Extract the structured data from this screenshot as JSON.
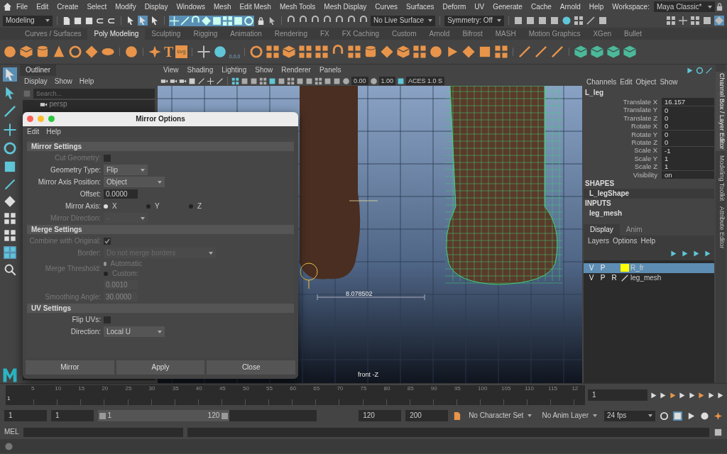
{
  "menu_bar": {
    "items": [
      "File",
      "Edit",
      "Create",
      "Select",
      "Modify",
      "Display",
      "Windows",
      "Mesh",
      "Edit Mesh",
      "Mesh Tools",
      "Mesh Display",
      "Curves",
      "Surfaces",
      "Deform",
      "UV",
      "Generate",
      "Cache",
      "Arnold",
      "Help"
    ],
    "workspace_label": "Workspace:",
    "workspace": "Maya Classic*"
  },
  "status_line": {
    "mode": "Modeling",
    "live_surface": "No Live Surface",
    "symmetry": "Symmetry: Off"
  },
  "shelf": {
    "tabs": [
      {
        "label": "Curves / Surfaces",
        "selected": false
      },
      {
        "label": "Poly Modeling",
        "selected": true
      },
      {
        "label": "Sculpting",
        "selected": false
      },
      {
        "label": "Rigging",
        "selected": false
      },
      {
        "label": "Animation",
        "selected": false
      },
      {
        "label": "Rendering",
        "selected": false
      },
      {
        "label": "FX",
        "selected": false
      },
      {
        "label": "FX Caching",
        "selected": false
      },
      {
        "label": "Custom",
        "selected": false
      },
      {
        "label": "Arnold",
        "selected": false
      },
      {
        "label": "Bifrost",
        "selected": false
      },
      {
        "label": "MASH",
        "selected": false
      },
      {
        "label": "Motion Graphics",
        "selected": false
      },
      {
        "label": "XGen",
        "selected": false
      },
      {
        "label": "Bullet",
        "selected": false
      }
    ],
    "glyphs": [
      "T",
      "svg",
      "0,0,0"
    ]
  },
  "outliner": {
    "title": "Outliner",
    "menu": [
      "Display",
      "Show",
      "Help"
    ],
    "search_placeholder": "Search...",
    "items": [
      "persp"
    ]
  },
  "viewport": {
    "menu": [
      "View",
      "Shading",
      "Lighting",
      "Show",
      "Renderer",
      "Panels"
    ],
    "exposure": "0.00",
    "gamma": "1.00",
    "color_space": "ACES 1.0 S",
    "measurement": "8.078502",
    "camera_label": "front -Z"
  },
  "dialog": {
    "title": "Mirror Options",
    "menu": [
      "Edit",
      "Help"
    ],
    "sections": [
      {
        "title": "Mirror Settings",
        "rows": [
          {
            "kind": "checkbox",
            "label": "Cut Geometry:",
            "checked": false,
            "disabled": true
          },
          {
            "kind": "dropdown",
            "label": "Geometry Type:",
            "value": "Flip",
            "disabled": false
          },
          {
            "kind": "dropdown",
            "label": "Mirror Axis Position:",
            "value": "Object",
            "disabled": false
          },
          {
            "kind": "field",
            "label": "Offset:",
            "value": "0.0000",
            "disabled": false
          },
          {
            "kind": "radio",
            "label": "Mirror Axis:",
            "disabled": false,
            "options": [
              {
                "label": "X",
                "selected": true
              },
              {
                "label": "Y",
                "selected": false
              },
              {
                "label": "Z",
                "selected": false
              }
            ]
          },
          {
            "kind": "dropdown",
            "label": "Mirror Direction:",
            "value": "-",
            "disabled": true
          }
        ]
      },
      {
        "title": "Merge Settings",
        "rows": [
          {
            "kind": "checkbox",
            "label": "Combine with Original:",
            "checked": true,
            "disabled": true
          },
          {
            "kind": "dropdown",
            "label": "Border:",
            "value": "Do not merge borders",
            "disabled": true
          },
          {
            "kind": "radio_stack",
            "label": "Merge Threshold:",
            "disabled": true,
            "options": [
              {
                "label": "Automatic",
                "selected": true
              },
              {
                "label": "Custom:",
                "selected": false
              }
            ]
          },
          {
            "kind": "field",
            "value": "0.0010",
            "disabled": true
          },
          {
            "kind": "field",
            "label": "Smoothing Angle:",
            "value": "30.0000",
            "disabled": true
          }
        ]
      },
      {
        "title": "UV Settings",
        "rows": [
          {
            "kind": "checkbox",
            "label": "Flip UVs:",
            "checked": false,
            "disabled": false
          },
          {
            "kind": "dropdown",
            "label": "Direction:",
            "value": "Local U",
            "disabled": false
          }
        ]
      }
    ],
    "buttons": [
      "Mirror",
      "Apply",
      "Close"
    ]
  },
  "channel_box": {
    "menu": [
      "Channels",
      "Edit",
      "Object",
      "Show"
    ],
    "object": "L_leg",
    "attributes": [
      {
        "name": "Translate X",
        "value": "16.157"
      },
      {
        "name": "Translate Y",
        "value": "0"
      },
      {
        "name": "Translate Z",
        "value": "0"
      },
      {
        "name": "Rotate X",
        "value": "0"
      },
      {
        "name": "Rotate Y",
        "value": "0"
      },
      {
        "name": "Rotate Z",
        "value": "0"
      },
      {
        "name": "Scale X",
        "value": "-1"
      },
      {
        "name": "Scale Y",
        "value": "1"
      },
      {
        "name": "Scale Z",
        "value": "1"
      },
      {
        "name": "Visibility",
        "value": "on"
      }
    ],
    "shapes_header": "SHAPES",
    "shape": "L_legShape",
    "inputs_header": "INPUTS",
    "input": "leg_mesh"
  },
  "layer_editor": {
    "tabs": [
      {
        "label": "Display",
        "selected": true
      },
      {
        "label": "Anim",
        "selected": false
      }
    ],
    "menu": [
      "Layers",
      "Options",
      "Help"
    ],
    "layers": [
      {
        "v": "V",
        "p": "P",
        "color": "#ffff00",
        "name": "R_fr",
        "selected": true
      },
      {
        "v": "V",
        "p": "P",
        "r": "R",
        "name": "leg_mesh",
        "selected": false
      }
    ]
  },
  "side_tabs": [
    {
      "label": "Channel Box / Layer Editor",
      "selected": true
    },
    {
      "label": "Modeling Toolkit",
      "selected": false
    },
    {
      "label": "Attribute Editor",
      "selected": false
    }
  ],
  "timeline": {
    "start_label": "1",
    "ticks": [
      "5",
      "10",
      "15",
      "20",
      "25",
      "30",
      "35",
      "40",
      "45",
      "50",
      "55",
      "60",
      "65",
      "70",
      "75",
      "80",
      "85",
      "90",
      "95",
      "100",
      "105",
      "110",
      "115",
      "12"
    ],
    "current_frame": "1"
  },
  "range": {
    "start": "1",
    "playback_start": "1",
    "slider_start": "1",
    "slider_end": "120",
    "level": 0.6,
    "playback_end": "120",
    "end": "200",
    "character_set": "No Character Set",
    "anim_layer": "No Anim Layer",
    "fps": "24 fps"
  },
  "command_line": {
    "label": "MEL"
  }
}
